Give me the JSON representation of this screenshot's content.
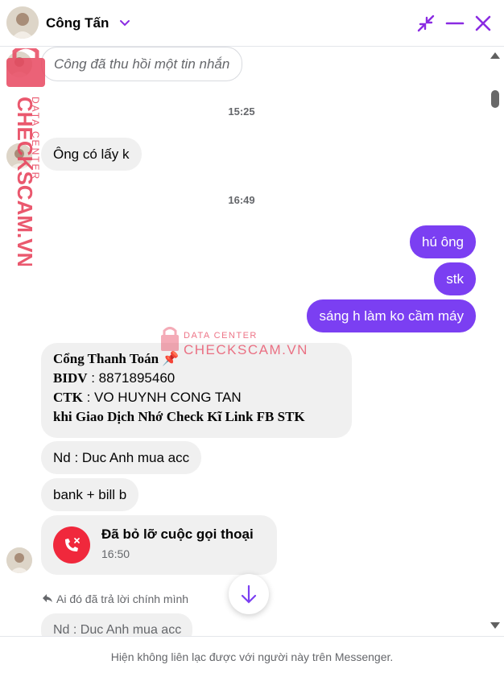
{
  "header": {
    "contact_name": "Công Tấn",
    "icons": [
      "chevron-down-icon",
      "minimize-window-icon",
      "minus-icon",
      "close-icon"
    ],
    "accent_color": "#8a2be2"
  },
  "messages": {
    "recalled_text": "Công đã thu hồi một tin nhắn",
    "time_1": "15:25",
    "incoming_1": "Ông có lấy k",
    "time_2": "16:49",
    "outgoing": [
      "hú ông",
      "stk",
      "sáng h làm ko cầm máy"
    ],
    "payment": {
      "heading": "Cổng Thanh Toán",
      "pin_emoji": "📌",
      "bank_label": "BIDV",
      "bank_value": " : 8871895460",
      "holder_label": "CTK",
      "holder_value": " : VO HUYNH CONG TAN",
      "warning": "khi Giao Dịch Nhớ Check Kĩ Link FB STK"
    },
    "incoming_2": "Nd : Duc Anh mua acc",
    "incoming_3": "bank + bill b",
    "missed_call": {
      "title": "Đã bỏ lỡ cuộc gọi thoại",
      "time": "16:50"
    },
    "reply_note": "Ai đó đã trả lời chính mình",
    "reply_preview": "Nd : Duc Anh mua acc"
  },
  "footer": {
    "notice": "Hiện không liên lạc được với người này trên Messenger."
  },
  "watermark": {
    "line1": "DATA CENTER",
    "line2": "CHECKSCAM.VN",
    "color": "#e8465f"
  },
  "colors": {
    "outgoing_bubble": "#7b3ff2",
    "incoming_bubble": "#f0f0f0",
    "missed_call": "#f0283c"
  }
}
